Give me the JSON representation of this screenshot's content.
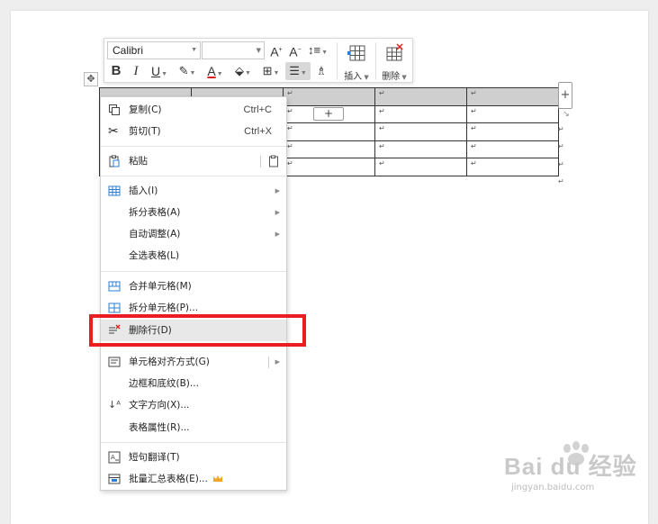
{
  "toolbar": {
    "font_name": "Calibri",
    "font_size": "",
    "increase_font": "A",
    "decrease_font": "A",
    "bold": "B",
    "italic": "I",
    "underline": "U",
    "font_color": "A",
    "insert_label": "插入",
    "delete_label": "删除"
  },
  "table": {
    "cell_mark": "↵",
    "add_symbol": "+"
  },
  "context_menu": {
    "items": [
      {
        "label": "复制(C)",
        "shortcut": "Ctrl+C",
        "icon": "copy-icon"
      },
      {
        "label": "剪切(T)",
        "shortcut": "Ctrl+X",
        "icon": "cut-icon"
      },
      {
        "label": "粘贴",
        "icon": "paste-icon"
      },
      {
        "label": "插入(I)",
        "icon": "insert-table-icon",
        "submenu": true
      },
      {
        "label": "拆分表格(A)",
        "submenu": true
      },
      {
        "label": "自动调整(A)",
        "submenu": true
      },
      {
        "label": "全选表格(L)"
      },
      {
        "label": "合并单元格(M)",
        "icon": "merge-cells-icon"
      },
      {
        "label": "拆分单元格(P)...",
        "icon": "split-cells-icon"
      },
      {
        "label": "删除行(D)",
        "icon": "delete-row-icon"
      },
      {
        "label": "单元格对齐方式(G)",
        "icon": "cell-align-icon",
        "submenu": true
      },
      {
        "label": "边框和底纹(B)..."
      },
      {
        "label": "文字方向(X)...",
        "icon": "text-direction-icon"
      },
      {
        "label": "表格属性(R)..."
      },
      {
        "label": "短句翻译(T)",
        "icon": "translate-icon"
      },
      {
        "label": "批量汇总表格(E)...",
        "icon": "summary-table-icon",
        "badge": "crown-icon"
      }
    ]
  },
  "watermark": {
    "main": "Bai du 经验",
    "sub": "jingyan.baidu.com"
  },
  "colors": {
    "highlight": "#ec1c24",
    "header_fill": "#cfcfcf",
    "crown": "#f5a623",
    "font_color_red": "#e02020"
  }
}
